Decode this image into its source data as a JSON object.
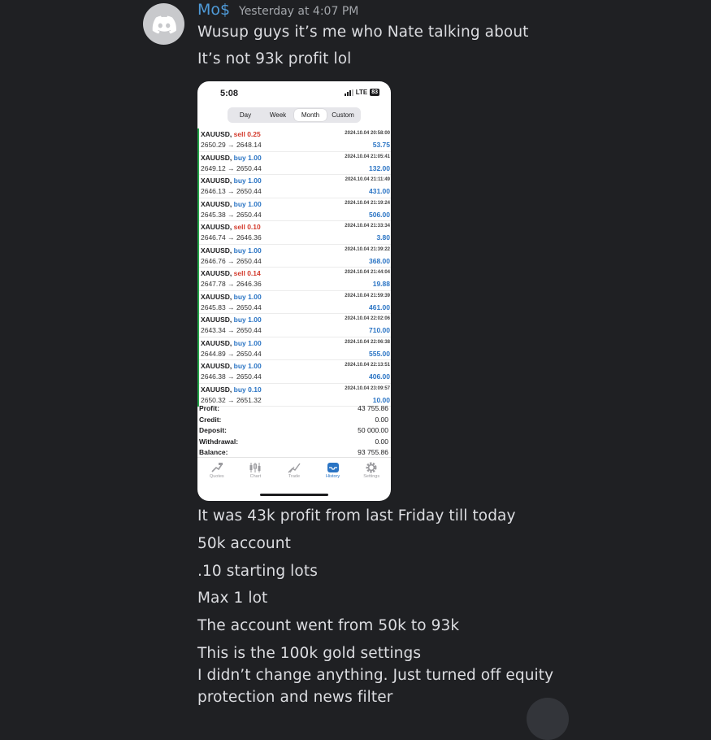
{
  "author": {
    "name": "Mo$",
    "timestamp": "Yesterday at 4:07 PM",
    "avatar_icon": "discord-logo-icon"
  },
  "messages_before": [
    "Wusup guys it’s me who Nate talking about",
    "It’s not 93k profit lol"
  ],
  "screenshot": {
    "status_time": "5:08",
    "network": "LTE",
    "battery": "83",
    "period_tabs": [
      "Day",
      "Week",
      "Month",
      "Custom"
    ],
    "active_period": "Month",
    "trades": [
      {
        "symbol": "XAUUSD,",
        "side": "sell",
        "lots": "0.25",
        "prices": "2650.29 → 2648.14",
        "time": "2024.10.04 20:58:00",
        "profit": "53.75"
      },
      {
        "symbol": "XAUUSD,",
        "side": "buy",
        "lots": "1.00",
        "prices": "2649.12 → 2650.44",
        "time": "2024.10.04 21:05:41",
        "profit": "132.00"
      },
      {
        "symbol": "XAUUSD,",
        "side": "buy",
        "lots": "1.00",
        "prices": "2646.13 → 2650.44",
        "time": "2024.10.04 21:11:49",
        "profit": "431.00"
      },
      {
        "symbol": "XAUUSD,",
        "side": "buy",
        "lots": "1.00",
        "prices": "2645.38 → 2650.44",
        "time": "2024.10.04 21:19:24",
        "profit": "506.00"
      },
      {
        "symbol": "XAUUSD,",
        "side": "sell",
        "lots": "0.10",
        "prices": "2646.74 → 2646.36",
        "time": "2024.10.04 21:33:34",
        "profit": "3.80"
      },
      {
        "symbol": "XAUUSD,",
        "side": "buy",
        "lots": "1.00",
        "prices": "2646.76 → 2650.44",
        "time": "2024.10.04 21:39:22",
        "profit": "368.00"
      },
      {
        "symbol": "XAUUSD,",
        "side": "sell",
        "lots": "0.14",
        "prices": "2647.78 → 2646.36",
        "time": "2024.10.04 21:44:04",
        "profit": "19.88"
      },
      {
        "symbol": "XAUUSD,",
        "side": "buy",
        "lots": "1.00",
        "prices": "2645.83 → 2650.44",
        "time": "2024.10.04 21:59:39",
        "profit": "461.00"
      },
      {
        "symbol": "XAUUSD,",
        "side": "buy",
        "lots": "1.00",
        "prices": "2643.34 → 2650.44",
        "time": "2024.10.04 22:02:06",
        "profit": "710.00"
      },
      {
        "symbol": "XAUUSD,",
        "side": "buy",
        "lots": "1.00",
        "prices": "2644.89 → 2650.44",
        "time": "2024.10.04 22:06:38",
        "profit": "555.00"
      },
      {
        "symbol": "XAUUSD,",
        "side": "buy",
        "lots": "1.00",
        "prices": "2646.38 → 2650.44",
        "time": "2024.10.04 22:13:51",
        "profit": "406.00"
      },
      {
        "symbol": "XAUUSD,",
        "side": "buy",
        "lots": "0.10",
        "prices": "2650.32 → 2651.32",
        "time": "2024.10.04 23:09:57",
        "profit": "10.00"
      }
    ],
    "summary": [
      {
        "label": "Profit:",
        "value": "43 755.86"
      },
      {
        "label": "Credit:",
        "value": "0.00"
      },
      {
        "label": "Deposit:",
        "value": "50 000.00"
      },
      {
        "label": "Withdrawal:",
        "value": "0.00"
      },
      {
        "label": "Balance:",
        "value": "93 755.86"
      }
    ],
    "nav": [
      {
        "label": "Quotes",
        "icon": "quotes-icon"
      },
      {
        "label": "Chart",
        "icon": "candlestick-chart-icon"
      },
      {
        "label": "Trade",
        "icon": "trade-chart-icon"
      },
      {
        "label": "History",
        "icon": "history-inbox-icon"
      },
      {
        "label": "Settings",
        "icon": "gear-icon"
      }
    ],
    "active_nav": "History",
    "colors": {
      "buy": "#2a74c4",
      "sell": "#d33a2c",
      "profit": "#2a74c4"
    }
  },
  "messages_after": [
    "It was 43k profit from last Friday till today",
    "50k account",
    ".10 starting lots",
    "Max 1 lot",
    "The account went from 50k to 93k",
    "This is the 100k gold settings",
    "I didn’t change anything. Just turned off equity",
    "protection and news filter"
  ],
  "theme": {
    "username_color": "#4f9bd9",
    "background": "#1f2023"
  }
}
